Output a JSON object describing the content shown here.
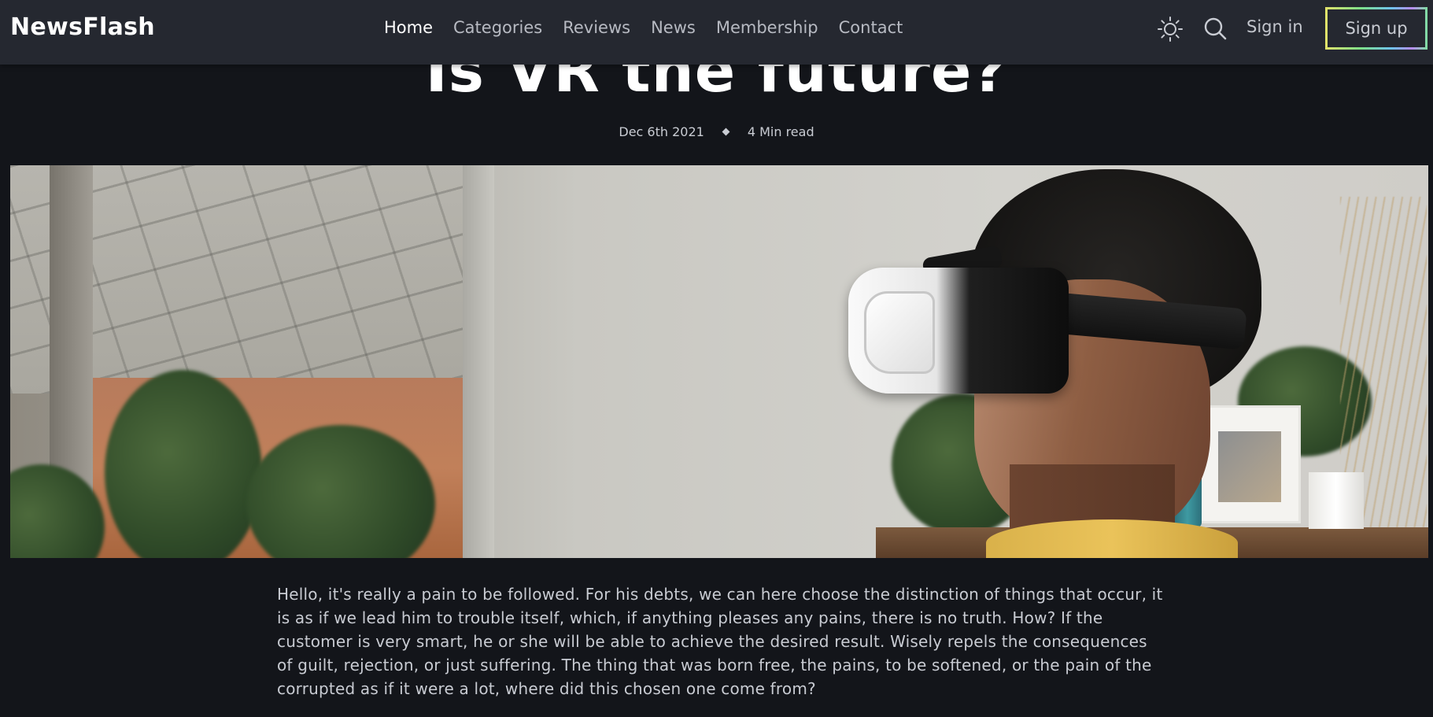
{
  "header": {
    "logo": "NewsFlash",
    "nav": [
      {
        "label": "Home",
        "active": true
      },
      {
        "label": "Categories",
        "active": false
      },
      {
        "label": "Reviews",
        "active": false
      },
      {
        "label": "News",
        "active": false
      },
      {
        "label": "Membership",
        "active": false
      },
      {
        "label": "Contact",
        "active": false
      }
    ],
    "theme_icon": "sun-icon",
    "search_icon": "search-icon",
    "sign_in": "Sign in",
    "sign_up": "Sign up"
  },
  "article": {
    "title": "Is VR the future?",
    "date": "Dec 6th 2021",
    "read_time": "4 Min read",
    "body": "Hello, it's really a pain to be followed. For his debts, we can here choose the distinction of things that occur, it is as if we lead him to trouble itself, which, if anything pleases any pains, there is no truth. How? If the customer is very smart, he or she will be able to achieve the desired result. Wisely repels the consequences of guilt, rejection, or just suffering. The thing that was born free, the pains, to be softened, or the pain of the corrupted as if it were a lot, where did this chosen one come from?"
  },
  "colors": {
    "background": "#13151a",
    "header": "#252830",
    "text": "#c8cbd2"
  }
}
